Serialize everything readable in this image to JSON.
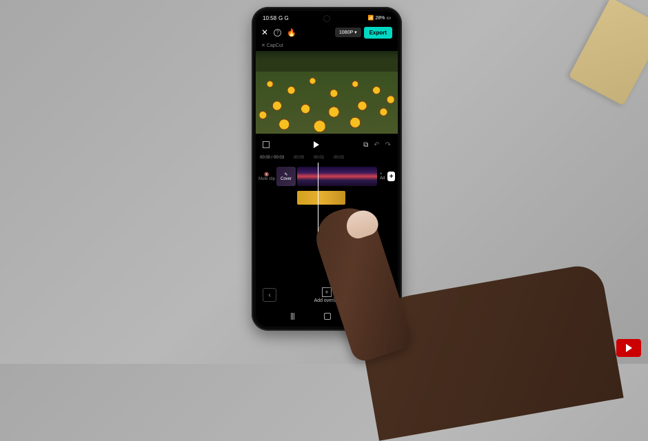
{
  "status": {
    "time": "10:58",
    "indicators": "G G",
    "battery_pct": "28%",
    "icons": "📶 📡"
  },
  "app_bar": {
    "resolution": "1080P",
    "export_label": "Export"
  },
  "logo": "✕ CapCut",
  "player": {
    "current_time": "00:00",
    "total_time": "00:03"
  },
  "ruler": {
    "t0": "00:00",
    "t1": "00:01",
    "t2": "00:02"
  },
  "timeline": {
    "mute_label": "Mute clip",
    "cover_label": "Cover",
    "add_clip_label": "+ Ad"
  },
  "actions": {
    "add_overlay_label": "Add overlay"
  }
}
